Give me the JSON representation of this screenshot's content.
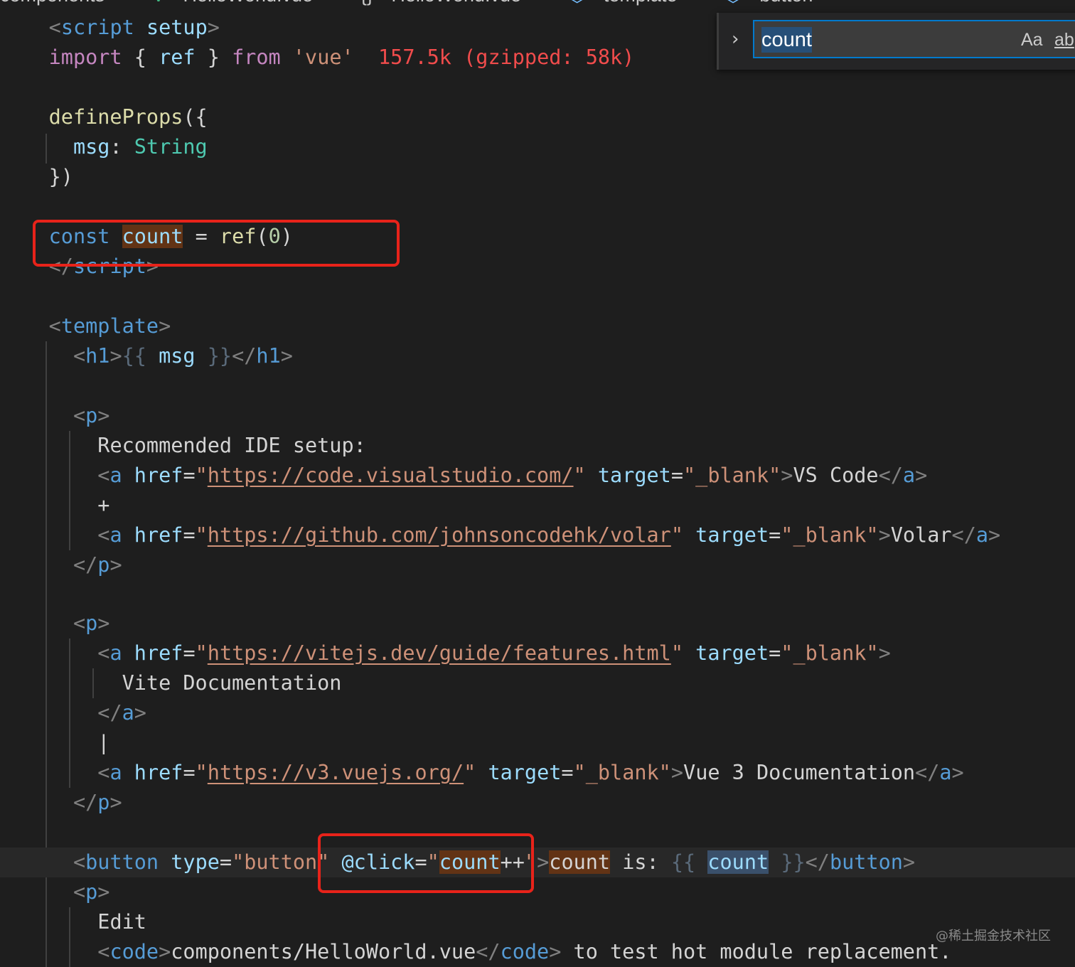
{
  "breadcrumb": {
    "items": [
      "components",
      "HelloWorld.vue",
      "HelloWorld.vue",
      "template",
      "button"
    ],
    "separator": ">"
  },
  "find_widget": {
    "query": "count",
    "match_case_label": "Aa",
    "whole_word_label": "ab"
  },
  "editor": {
    "script_open_tag": "script",
    "script_attr": "setup",
    "import_kw": "import",
    "import_names": "ref",
    "from_kw": "from",
    "import_module": "'vue'",
    "import_cost": "157.5k (gzipped: 58k)",
    "define_props": "defineProps",
    "prop_name": "msg",
    "prop_type": "String",
    "const_kw": "const",
    "count_var": "count",
    "ref_fn": "ref",
    "ref_arg": "0",
    "script_close_tag": "script",
    "template_tag": "template",
    "h1_tag": "h1",
    "msg_ref": "msg",
    "p_tag": "p",
    "recommended_text": "Recommended IDE setup:",
    "a_tag": "a",
    "href_attr": "href",
    "target_attr": "target",
    "target_value": "\"_blank\"",
    "vscode_url": "https://code.visualstudio.com/",
    "vscode_label": "VS Code",
    "plus_text": "+",
    "volar_url": "https://github.com/johnsoncodehk/volar",
    "volar_label": "Volar",
    "vite_url": "https://vitejs.dev/guide/features.html",
    "vite_label": "Vite Documentation",
    "pipe_text": "|",
    "vue_url": "https://v3.vuejs.org/",
    "vue_label": "Vue 3 Documentation",
    "button_tag": "button",
    "type_attr": "type",
    "type_value": "\"button\"",
    "click_attr": "@click",
    "click_expr": "count",
    "click_op": "++",
    "button_text_count": "count",
    "button_text_is": " is: ",
    "edit_text": "Edit",
    "code_tag": "code",
    "code_path": "components/HelloWorld.vue",
    "hot_text": " to test hot module replacement."
  },
  "watermark": "@稀土掘金技术社区",
  "colors": {
    "background": "#1e1e1e",
    "highlight_box": "#e8231a",
    "find_match": "#623315",
    "find_border": "#007acc"
  }
}
